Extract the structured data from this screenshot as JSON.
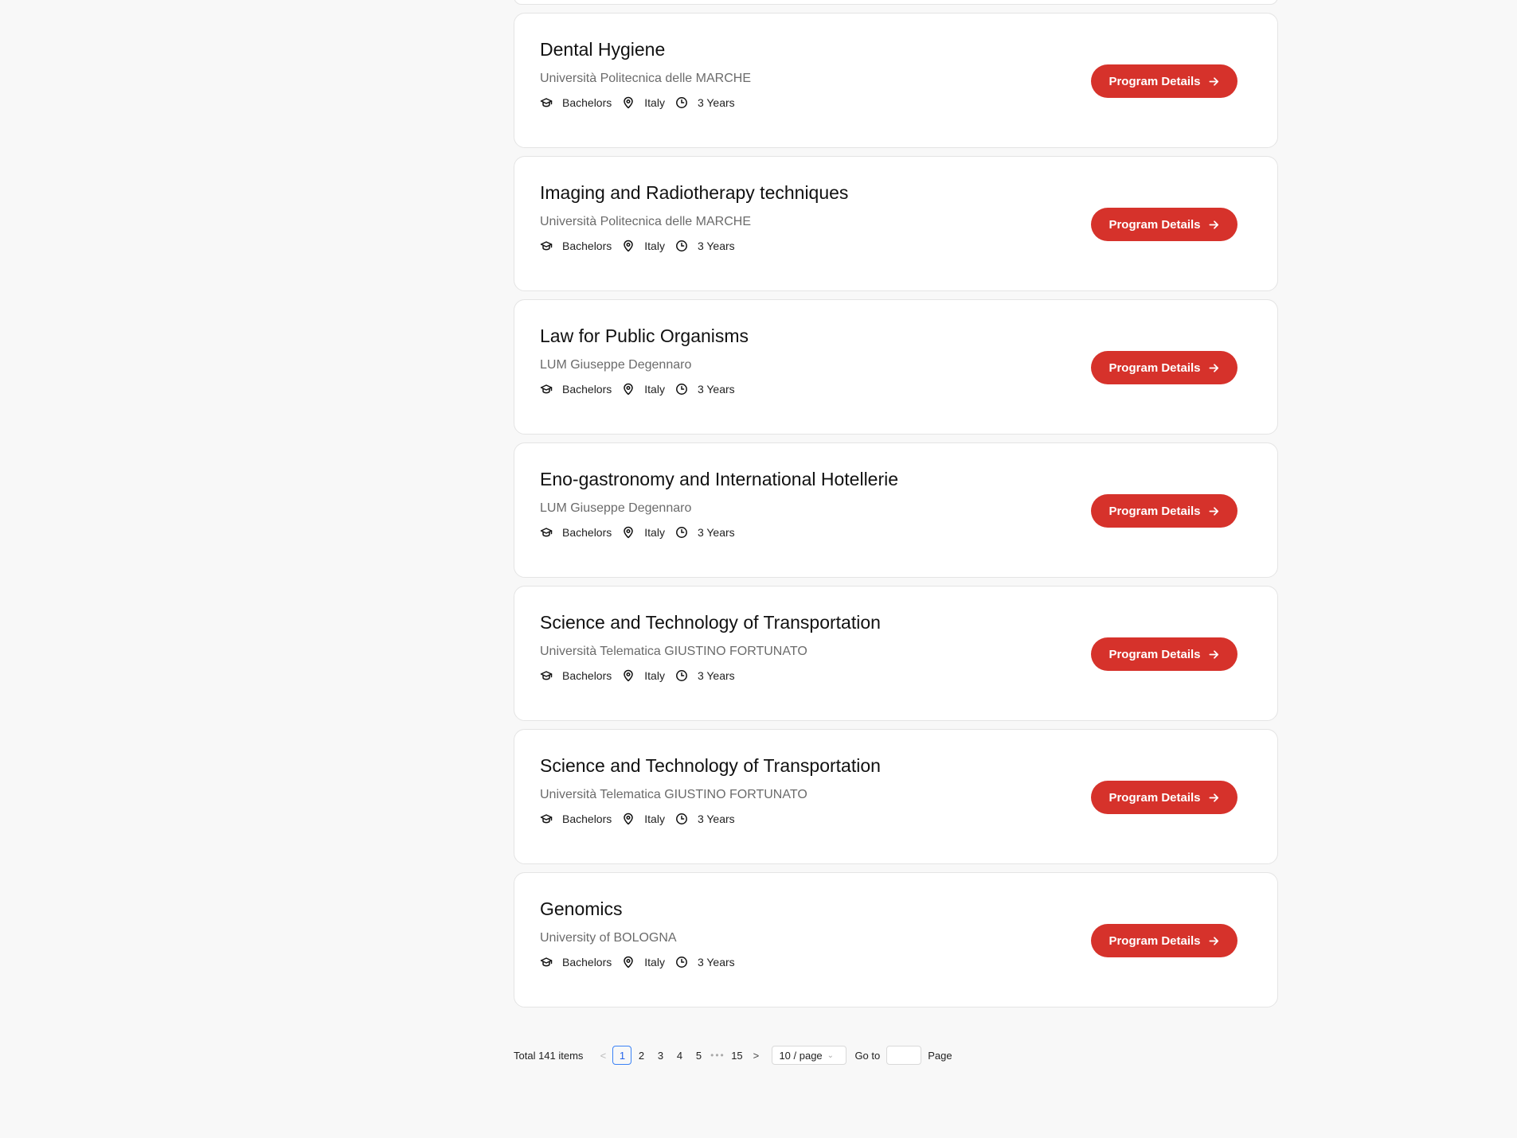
{
  "programs": [
    {
      "title": "Dental Hygiene",
      "university": "Università Politecnica delle MARCHE",
      "level": "Bachelors",
      "country": "Italy",
      "duration": "3 Years",
      "button": "Program Details"
    },
    {
      "title": "Imaging and Radiotherapy techniques",
      "university": "Università Politecnica delle MARCHE",
      "level": "Bachelors",
      "country": "Italy",
      "duration": "3 Years",
      "button": "Program Details"
    },
    {
      "title": "Law for Public Organisms",
      "university": "LUM Giuseppe Degennaro",
      "level": "Bachelors",
      "country": "Italy",
      "duration": "3 Years",
      "button": "Program Details"
    },
    {
      "title": "Eno-gastronomy and International Hotellerie",
      "university": "LUM Giuseppe Degennaro",
      "level": "Bachelors",
      "country": "Italy",
      "duration": "3 Years",
      "button": "Program Details"
    },
    {
      "title": "Science and Technology of Transportation",
      "university": "Università Telematica GIUSTINO FORTUNATO",
      "level": "Bachelors",
      "country": "Italy",
      "duration": "3 Years",
      "button": "Program Details"
    },
    {
      "title": "Science and Technology of Transportation",
      "university": "Università Telematica GIUSTINO FORTUNATO",
      "level": "Bachelors",
      "country": "Italy",
      "duration": "3 Years",
      "button": "Program Details"
    },
    {
      "title": "Genomics",
      "university": "University of BOLOGNA",
      "level": "Bachelors",
      "country": "Italy",
      "duration": "3 Years",
      "button": "Program Details"
    }
  ],
  "icons": {
    "level": "graduation-cap-icon",
    "country": "map-pin-icon",
    "duration": "clock-icon",
    "button": "arrow-right-icon"
  },
  "colors": {
    "accent": "#d6322b",
    "active_page": "#2563eb"
  },
  "pagination": {
    "total_label": "Total 141 items",
    "prev": "<",
    "pages": [
      "1",
      "2",
      "3",
      "4",
      "5"
    ],
    "ellipsis": "•••",
    "last_page": "15",
    "next": ">",
    "active_page": "1",
    "page_size": "10 / page",
    "goto_label": "Go to",
    "goto_value": "",
    "page_label": "Page"
  }
}
